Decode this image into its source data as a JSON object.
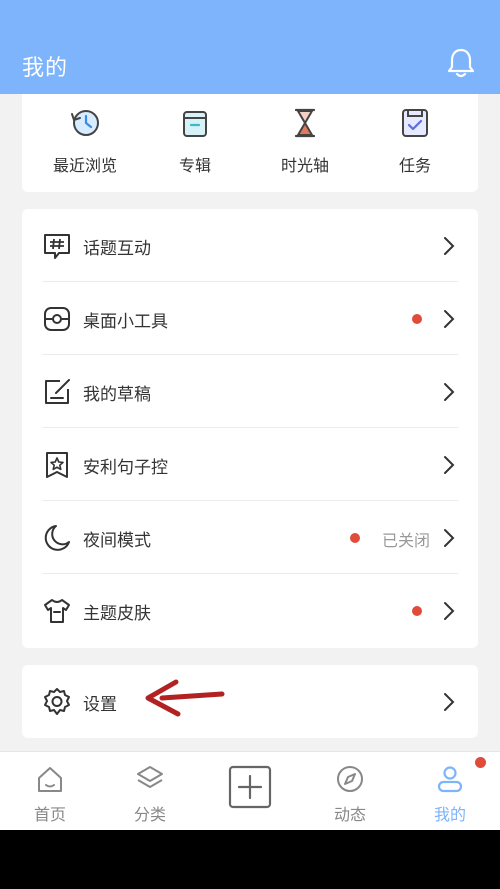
{
  "header": {
    "title": "我的"
  },
  "quick": [
    {
      "label": "最近浏览",
      "icon": "clock-history-icon"
    },
    {
      "label": "专辑",
      "icon": "album-box-icon"
    },
    {
      "label": "时光轴",
      "icon": "hourglass-icon"
    },
    {
      "label": "任务",
      "icon": "task-check-icon"
    }
  ],
  "menu": [
    {
      "label": "话题互动",
      "icon": "hashtag-chat-icon",
      "dot": false,
      "status": ""
    },
    {
      "label": "桌面小工具",
      "icon": "widget-icon",
      "dot": true,
      "status": ""
    },
    {
      "label": "我的草稿",
      "icon": "draft-edit-icon",
      "dot": false,
      "status": ""
    },
    {
      "label": "安利句子控",
      "icon": "star-bookmark-icon",
      "dot": false,
      "status": ""
    },
    {
      "label": "夜间模式",
      "icon": "moon-icon",
      "dot": true,
      "status": "已关闭"
    },
    {
      "label": "主题皮肤",
      "icon": "tshirt-icon",
      "dot": true,
      "status": ""
    }
  ],
  "settings": {
    "label": "设置",
    "icon": "gear-icon"
  },
  "tabs": [
    {
      "label": "首页",
      "icon": "home-icon",
      "active": false
    },
    {
      "label": "分类",
      "icon": "layers-icon",
      "active": false
    },
    {
      "label": "",
      "icon": "add-square-icon",
      "active": false
    },
    {
      "label": "动态",
      "icon": "compass-icon",
      "active": false
    },
    {
      "label": "我的",
      "icon": "user-icon",
      "active": true,
      "badge": true
    }
  ],
  "colors": {
    "accent": "#7db4fb",
    "badge": "#e04b3a",
    "annotation_arrow": "#b22222"
  }
}
